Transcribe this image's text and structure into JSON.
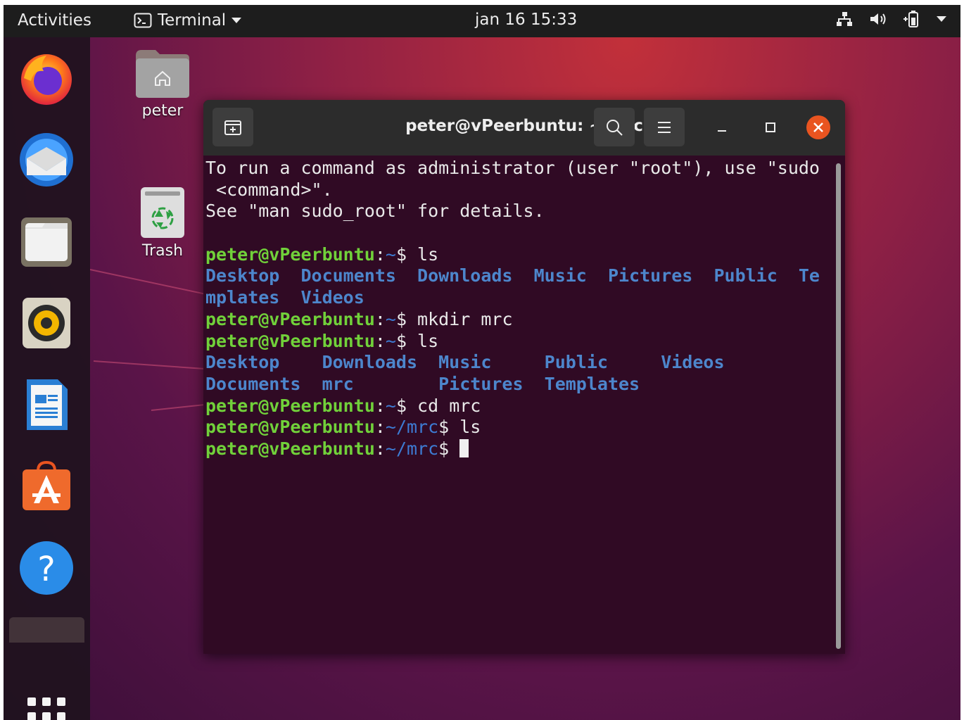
{
  "topbar": {
    "activities": "Activities",
    "app_menu_label": "Terminal",
    "clock": "jan 16  15:33",
    "tray_icons": [
      "network-icon",
      "volume-icon",
      "battery-icon",
      "chevron-down-icon"
    ]
  },
  "dock": {
    "items": [
      "Firefox",
      "Thunderbird",
      "Files",
      "Rhythmbox",
      "LibreOffice Writer",
      "Ubuntu Software",
      "Help"
    ],
    "show_apps_icon": "grid-icon"
  },
  "desktop": {
    "icons": [
      {
        "label": "peter",
        "icon": "home-folder-icon"
      },
      {
        "label": "Trash",
        "icon": "trash-icon"
      }
    ]
  },
  "terminal": {
    "title": "peter@vPeerbuntu: ~/mrc",
    "lines": [
      [
        {
          "t": "To run a command as administrator (user \"root\"), use \"sudo"
        }
      ],
      [
        {
          "t": " <command>\"."
        }
      ],
      [
        {
          "t": "See \"man sudo_root\" for details."
        }
      ],
      [
        {
          "t": ""
        }
      ],
      [
        {
          "t": "peter@vPeerbuntu",
          "c": "ug"
        },
        {
          "t": ":"
        },
        {
          "t": "~",
          "c": "ub"
        },
        {
          "t": "$ ls"
        }
      ],
      [
        {
          "t": "Desktop  Documents  Downloads  Music  Pictures  Public  Te",
          "c": "bl"
        }
      ],
      [
        {
          "t": "mplates  Videos",
          "c": "bl"
        }
      ],
      [
        {
          "t": "peter@vPeerbuntu",
          "c": "ug"
        },
        {
          "t": ":"
        },
        {
          "t": "~",
          "c": "ub"
        },
        {
          "t": "$ mkdir mrc"
        }
      ],
      [
        {
          "t": "peter@vPeerbuntu",
          "c": "ug"
        },
        {
          "t": ":"
        },
        {
          "t": "~",
          "c": "ub"
        },
        {
          "t": "$ ls"
        }
      ],
      [
        {
          "t": "Desktop    Downloads  Music     Public     Videos",
          "c": "bl"
        }
      ],
      [
        {
          "t": "Documents  mrc        Pictures  Templates",
          "c": "bl"
        }
      ],
      [
        {
          "t": "peter@vPeerbuntu",
          "c": "ug"
        },
        {
          "t": ":"
        },
        {
          "t": "~",
          "c": "ub"
        },
        {
          "t": "$ cd mrc"
        }
      ],
      [
        {
          "t": "peter@vPeerbuntu",
          "c": "ug"
        },
        {
          "t": ":"
        },
        {
          "t": "~/mrc",
          "c": "ub"
        },
        {
          "t": "$ ls"
        }
      ],
      [
        {
          "t": "peter@vPeerbuntu",
          "c": "ug"
        },
        {
          "t": ":"
        },
        {
          "t": "~/mrc",
          "c": "ub"
        },
        {
          "t": "$ "
        }
      ]
    ]
  },
  "colors": {
    "prompt_user": "#71d13a",
    "prompt_path": "#3d7bd3",
    "dir_listing": "#4d86cc",
    "terminal_bg": "#300a24",
    "close_button": "#e95420"
  }
}
